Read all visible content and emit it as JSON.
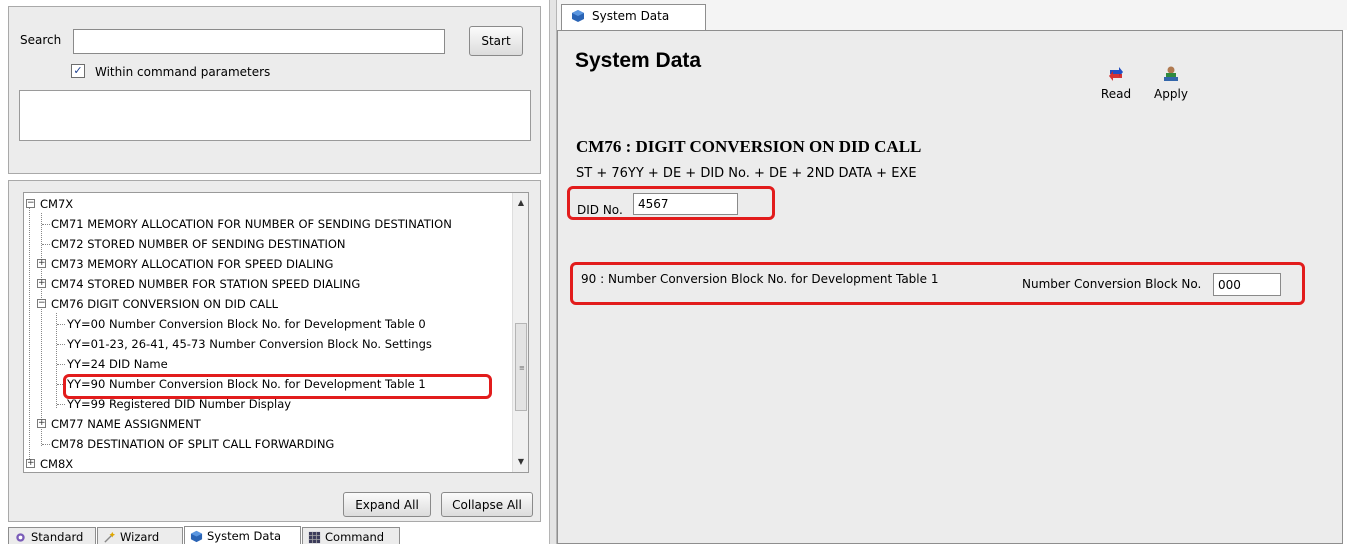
{
  "search": {
    "label": "Search",
    "value": "",
    "start_button": "Start",
    "within_checked": true,
    "checkbox_mark": "✓",
    "within_label": "Within command parameters"
  },
  "tree": {
    "items": [
      {
        "sign": "−",
        "label": "CM7X"
      },
      {
        "sign": "",
        "label": "CM71 MEMORY ALLOCATION FOR NUMBER OF SENDING DESTINATION"
      },
      {
        "sign": "",
        "label": "CM72 STORED NUMBER OF SENDING DESTINATION"
      },
      {
        "sign": "+",
        "label": "CM73 MEMORY ALLOCATION FOR SPEED DIALING"
      },
      {
        "sign": "+",
        "label": "CM74 STORED NUMBER FOR STATION SPEED DIALING"
      },
      {
        "sign": "−",
        "label": "CM76 DIGIT CONVERSION ON DID CALL"
      },
      {
        "sign": "",
        "label": "YY=00 Number Conversion Block No. for Development Table 0"
      },
      {
        "sign": "",
        "label": "YY=01-23, 26-41, 45-73 Number Conversion Block No. Settings"
      },
      {
        "sign": "",
        "label": "YY=24 DID Name"
      },
      {
        "sign": "",
        "label": "YY=90 Number Conversion Block No. for Development Table 1"
      },
      {
        "sign": "",
        "label": "YY=99 Registered DID Number Display"
      },
      {
        "sign": "+",
        "label": "CM77 NAME ASSIGNMENT"
      },
      {
        "sign": "",
        "label": "CM78 DESTINATION OF SPLIT CALL FORWARDING"
      },
      {
        "sign": "+",
        "label": "CM8X"
      }
    ],
    "selected_item": "YY=90 Number Conversion Block No. for Development Table 1",
    "expand_all": "Expand All",
    "collapse_all": "Collapse All"
  },
  "bottom_tabs": [
    {
      "label": "Standard",
      "icon": "gear-icon"
    },
    {
      "label": "Wizard",
      "icon": "wizard-icon"
    },
    {
      "label": "System Data",
      "icon": "cube-icon",
      "active": true
    },
    {
      "label": "Command",
      "icon": "grid-icon"
    }
  ],
  "right": {
    "tab_label": "System Data",
    "page_title": "System Data",
    "read_label": "Read",
    "apply_label": "Apply",
    "command_title": "CM76 : DIGIT CONVERSION ON DID CALL",
    "command_formula": "ST + 76YY + DE + DID No. + DE + 2ND DATA + EXE",
    "did_label": "DID No.",
    "did_value": "4567",
    "param_label": "90 : Number Conversion Block No. for Development Table 1",
    "ncb_label": "Number Conversion Block No.",
    "ncb_value": "000"
  },
  "colors": {
    "highlight": "#e21c1c",
    "panel_bg": "#ececec",
    "tab_border": "#8e8e8e"
  }
}
